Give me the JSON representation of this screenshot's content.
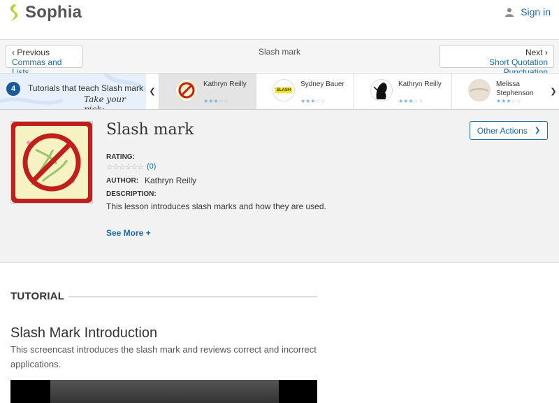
{
  "header": {
    "logo_text": "Sophia",
    "signin_label": "Sign in"
  },
  "nav": {
    "prev_label": "Previous",
    "prev_title": "Commas and Lists",
    "current_title": "Slash mark",
    "next_label": "Next",
    "next_title": "Short Quotation Punctuation"
  },
  "strip": {
    "count": "4",
    "label": "Tutorials that teach Slash mark",
    "pick_text": "Take your pick:",
    "cards": [
      {
        "name": "Kathryn Reilly",
        "stars": 3,
        "active": true
      },
      {
        "name": "Sydney Bauer",
        "stars": 3,
        "active": false,
        "thumb_text": "SLASH"
      },
      {
        "name": "Kathryn Reilly",
        "stars": 3,
        "active": false
      },
      {
        "name": "Melissa Stephenson",
        "stars": 3,
        "active": false
      }
    ]
  },
  "lesson": {
    "title": "Slash mark",
    "other_actions_label": "Other Actions",
    "rating_label": "RATING:",
    "rating_count": "(0)",
    "author_label": "AUTHOR:",
    "author_name": "Kathryn Reilly",
    "description_label": "DESCRIPTION:",
    "description": "This lesson introduces slash marks and how they are used.",
    "see_more_label": "See More +"
  },
  "tutorial": {
    "section_heading": "TUTORIAL",
    "title": "Slash Mark Introduction",
    "description": "This screencast introduces the slash mark and reviews correct and incorrect applications."
  },
  "colors": {
    "link_blue": "#1a6aa8",
    "badge_blue": "#1a5a99",
    "logo_green": "#b5d334"
  }
}
